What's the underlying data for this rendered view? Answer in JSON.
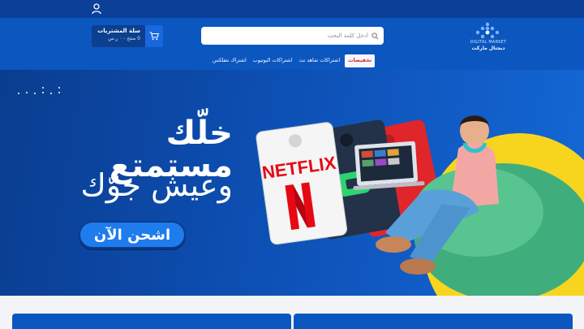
{
  "header": {
    "logo_en": "DIGITAL MARKET",
    "logo_ar": "ديجتال ماركت",
    "search_placeholder": "أدخل كلمة البحث",
    "cart_title": "سلة المشتريات",
    "cart_sub": "0 منتج - ٠ ر.س"
  },
  "nav": {
    "items": [
      {
        "label": "تخفيضات",
        "active": true
      },
      {
        "label": "اشتراكات شاهد نت",
        "active": false
      },
      {
        "label": "اشتراكات اليوتيوب",
        "active": false
      },
      {
        "label": "اشتراك نتفلكس",
        "active": false
      }
    ]
  },
  "hero": {
    "line1": "خلّك مستمتع",
    "line2": "وعيش جوّك",
    "cta": "اشحن الآن",
    "card_brand": "NETFLIX"
  },
  "icons": {
    "user": "user-icon",
    "search": "search-icon",
    "cart": "cart-icon"
  },
  "colors": {
    "topbar": "#0b3f98",
    "header": "#0c56bf",
    "accent_red": "#d3242a",
    "hero_yellow": "#f7d51e",
    "cta_blue": "#1f7cec"
  }
}
